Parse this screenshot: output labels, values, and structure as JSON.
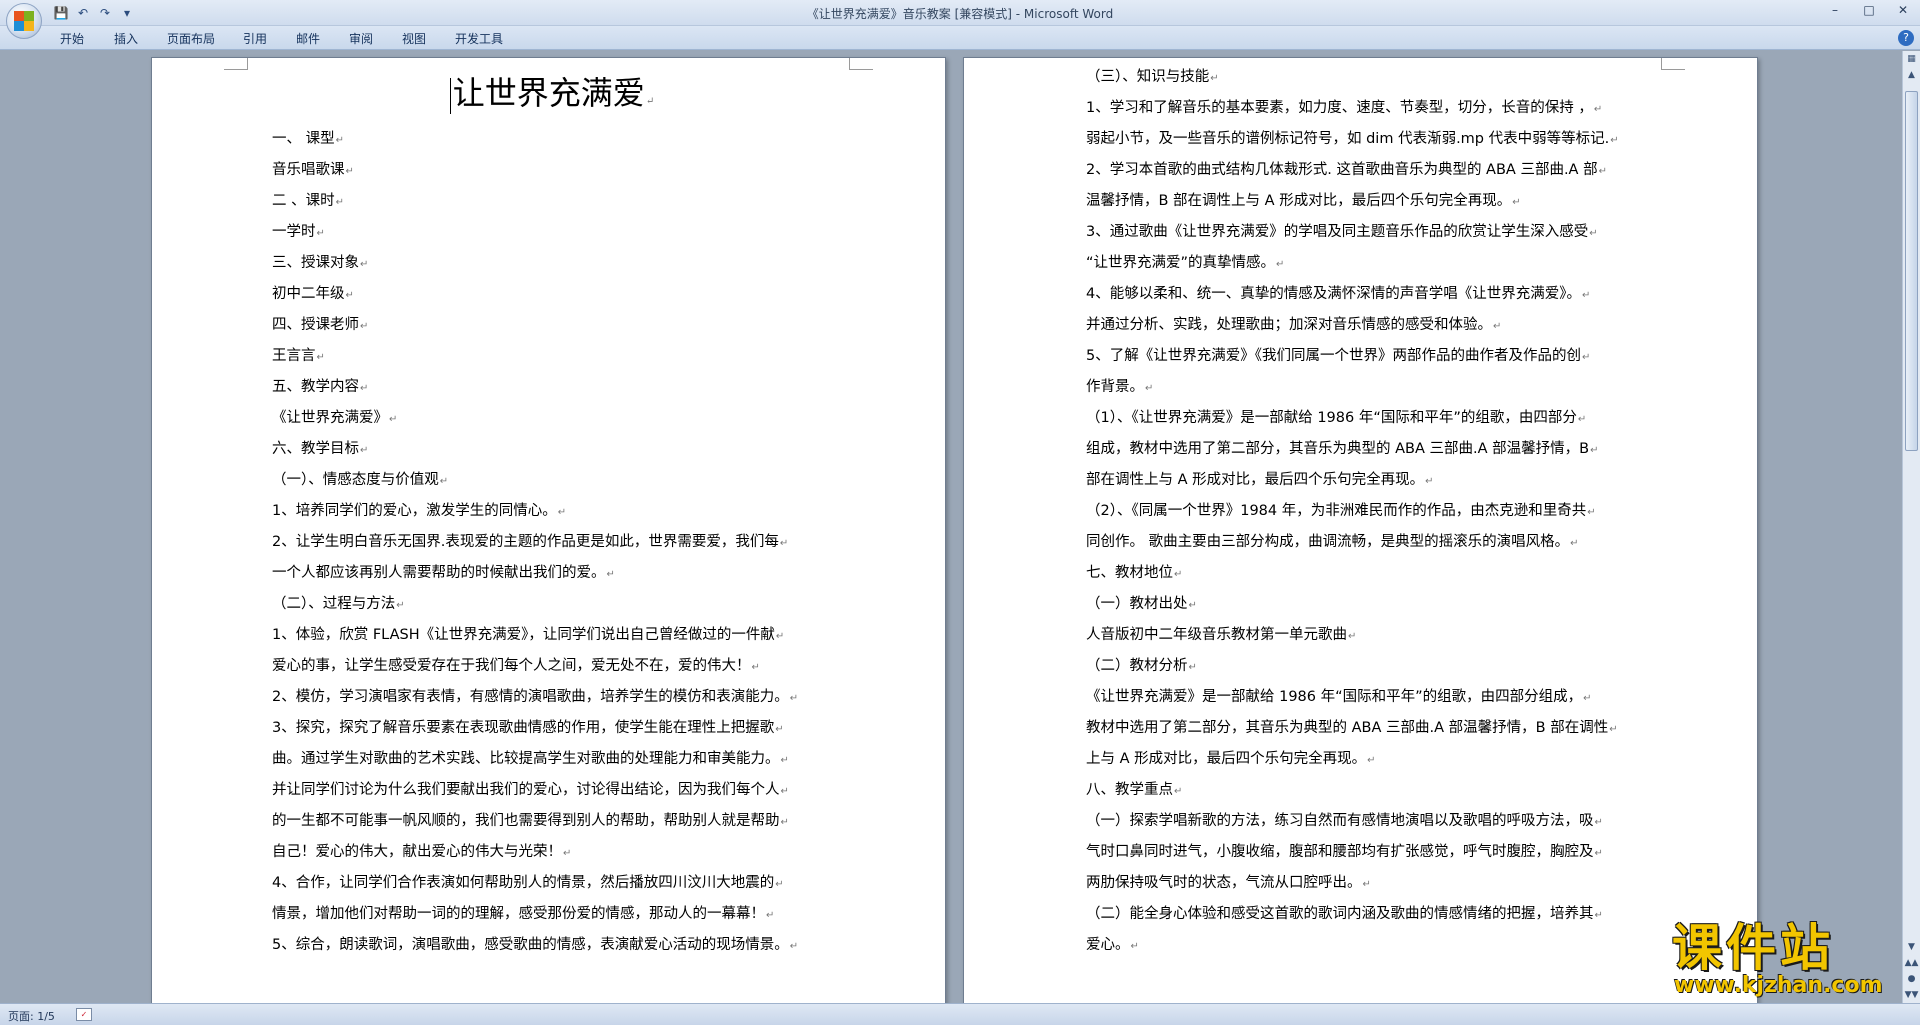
{
  "window": {
    "title": "《让世界充满爱》音乐教案 [兼容模式] - Microsoft Word"
  },
  "quick_access": {
    "save_icon": "save-icon",
    "undo_icon": "undo-icon",
    "redo_icon": "redo-icon",
    "customize_icon": "chevron-down-icon"
  },
  "ribbon": {
    "tabs": [
      "开始",
      "插入",
      "页面布局",
      "引用",
      "邮件",
      "审阅",
      "视图",
      "开发工具"
    ]
  },
  "pages": {
    "left": {
      "title": "让世界充满爱",
      "lines": [
        "一、 课型",
        "音乐唱歌课",
        "二 、课时",
        "一学时",
        "三、授课对象",
        "初中二年级",
        "四、授课老师",
        "王言言",
        "五、教学内容",
        "《让世界充满爱》",
        "六、教学目标",
        "（一）、情感态度与价值观",
        "1、培养同学们的爱心，激发学生的同情心。",
        "2、让学生明白音乐无国界.表现爱的主题的作品更是如此，世界需要爱，我们每",
        "一个人都应该再别人需要帮助的时候献出我们的爱。",
        "（二）、过程与方法",
        "1、体验，欣赏 FLASH《让世界充满爱》，让同学们说出自己曾经做过的一件献",
        "爱心的事，让学生感受爱存在于我们每个人之间，爱无处不在，爱的伟大！",
        "2、模仿，学习演唱家有表情，有感情的演唱歌曲，培养学生的模仿和表演能力。",
        "3、探究，探究了解音乐要素在表现歌曲情感的作用，使学生能在理性上把握歌",
        "曲。通过学生对歌曲的艺术实践、比较提高学生对歌曲的处理能力和审美能力。",
        "并让同学们讨论为什么我们要献出我们的爱心，讨论得出结论，因为我们每个人",
        "的一生都不可能事一帆风顺的，我们也需要得到别人的帮助，帮助别人就是帮助",
        "自己！爱心的伟大，献出爱心的伟大与光荣！",
        "4、合作，让同学们合作表演如何帮助别人的情景，然后播放四川汶川大地震的",
        "情景，增加他们对帮助一词的的理解，感受那份爱的情感，那动人的一幕幕！",
        "5、综合，朗读歌词，演唱歌曲，感受歌曲的情感，表演献爱心活动的现场情景。"
      ]
    },
    "right": {
      "lines": [
        "（三）、知识与技能",
        "1、学习和了解音乐的基本要素，如力度、速度、节奏型，切分，长音的保持 ，",
        "弱起小节，及一些音乐的谱例标记符号，如 dim 代表渐弱.mp 代表中弱等等标记.",
        "2、学习本首歌的曲式结构几体裁形式. 这首歌曲音乐为典型的 ABA 三部曲.A 部",
        "温馨抒情，B 部在调性上与 A 形成对比，最后四个乐句完全再现。",
        "3、通过歌曲《让世界充满爱》的学唱及同主题音乐作品的欣赏让学生深入感受",
        "“让世界充满爱”的真挚情感。",
        "4、能够以柔和、统一、真挚的情感及满怀深情的声音学唱《让世界充满爱》。",
        "并通过分析、实践，处理歌曲；加深对音乐情感的感受和体验。",
        "5、了解《让世界充满爱》《我们同属一个世界》两部作品的曲作者及作品的创",
        "作背景。",
        "（1）、《让世界充满爱》是一部献给 1986 年“国际和平年”的组歌，由四部分",
        "组成，教材中选用了第二部分，其音乐为典型的 ABA 三部曲.A 部温馨抒情，B",
        "部在调性上与 A 形成对比，最后四个乐句完全再现。",
        "（2）、《同属一个世界》1984 年，为非洲难民而作的作品，由杰克逊和里奇共",
        "同创作。 歌曲主要由三部分构成，曲调流畅，是典型的摇滚乐的演唱风格。",
        "七、教材地位",
        "（一）教材出处",
        "人音版初中二年级音乐教材第一单元歌曲",
        "（二）教材分析",
        "《让世界充满爱》是一部献给 1986 年“国际和平年”的组歌，由四部分组成，",
        "教材中选用了第二部分，其音乐为典型的 ABA 三部曲.A 部温馨抒情，B 部在调性",
        "上与 A 形成对比，最后四个乐句完全再现。",
        "八、教学重点",
        "（一）探索学唱新歌的方法，练习自然而有感情地演唱以及歌唱的呼吸方法，吸",
        "气时口鼻同时进气，小腹收缩，腹部和腰部均有扩张感觉，呼气时腹腔，胸腔及",
        "两肋保持吸气时的状态，气流从口腔呼出。",
        "（二）能全身心体验和感受这首歌的歌词内涵及歌曲的情感情绪的把握，培养其",
        "爱心。"
      ]
    }
  },
  "status": {
    "page_label": "页面: 1/5"
  },
  "watermark": {
    "main": "课件站",
    "url": "www.kjzhan.com"
  }
}
